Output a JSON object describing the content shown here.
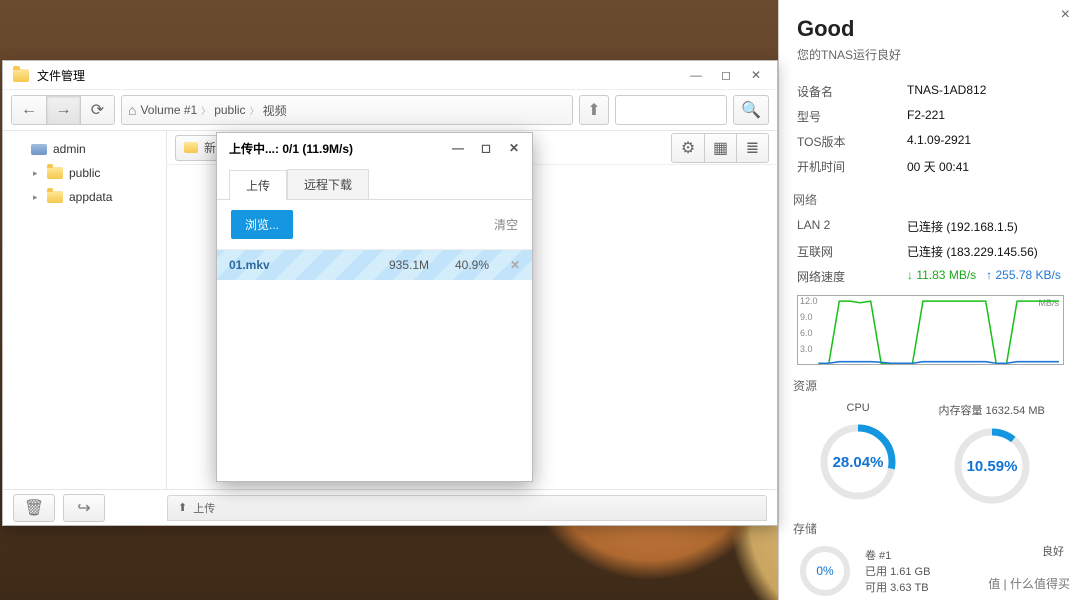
{
  "file_manager": {
    "title": "文件管理",
    "nav": {
      "back_icon": "←",
      "forward_icon": "→",
      "refresh_icon": "⟳"
    },
    "breadcrumb": [
      "Volume #1",
      "public",
      "视频"
    ],
    "search": {
      "placeholder": ""
    },
    "tree": {
      "root": "admin",
      "items": [
        "public",
        "appdata"
      ]
    },
    "new_folder_partial": "新",
    "view_icons": {
      "gear": "⚙",
      "grid": "▦",
      "list": "≣"
    },
    "footer": {
      "trash_icon": "🗑",
      "share_icon": "↪",
      "upload_tab_icon": "⬆",
      "upload_tab_label": "上传"
    }
  },
  "upload_dialog": {
    "title": "上传中...: 0/1 (11.9M/s)",
    "tabs": {
      "upload": "上传",
      "remote": "远程下载"
    },
    "browse": "浏览...",
    "clear": "清空",
    "item": {
      "name": "01.mkv",
      "size": "935.1M",
      "percent": "40.9%"
    }
  },
  "system": {
    "status_title": "Good",
    "status_sub": "您的TNAS运行良好",
    "close_icon": "×",
    "device": {
      "name_k": "设备名",
      "name_v": "TNAS-1AD812",
      "model_k": "型号",
      "model_v": "F2-221",
      "tos_k": "TOS版本",
      "tos_v": "4.1.09-2921",
      "uptime_k": "开机时间",
      "uptime_v": "00 天 00:41"
    },
    "network": {
      "header": "网络",
      "lan_k": "LAN 2",
      "lan_v": "已连接 (192.168.1.5)",
      "inet_k": "互联网",
      "inet_v": "已连接 (183.229.145.56)",
      "speed_k": "网络速度",
      "down": "11.83 MB/s",
      "up": "255.78 KB/s",
      "unit_label": "MB/s"
    },
    "resources": {
      "header": "资源",
      "cpu_label": "CPU",
      "cpu_pct": "28.04%",
      "mem_label": "内存容量 1632.54 MB",
      "mem_pct": "10.59%"
    },
    "storage": {
      "header": "存储",
      "vol": "卷 #1",
      "status": "良好",
      "pct": "0%",
      "used_k": "已用",
      "used_v": "1.61 GB",
      "avail_k": "可用",
      "avail_v": "3.63 TB"
    }
  },
  "chart_data": {
    "type": "line",
    "title": "",
    "xlabel": "",
    "ylabel": "MB/s",
    "ylim": [
      0,
      12
    ],
    "y_ticks": [
      3.0,
      6.0,
      9.0,
      12.0
    ],
    "series": [
      {
        "name": "download",
        "color": "#19c019",
        "values": [
          0,
          0,
          11.8,
          11.8,
          11.5,
          11.8,
          0,
          0,
          0,
          0,
          11.8,
          11.8,
          11.8,
          11.8,
          11.8,
          11.8,
          11.8,
          0,
          0,
          11.8,
          11.8,
          11.8,
          11.8,
          11.8
        ]
      },
      {
        "name": "upload",
        "color": "#1e77d8",
        "values": [
          0,
          0,
          0.3,
          0.3,
          0.3,
          0.3,
          0.2,
          0,
          0,
          0,
          0.3,
          0.3,
          0.3,
          0.3,
          0.3,
          0.3,
          0.3,
          0,
          0,
          0.3,
          0.3,
          0.3,
          0.3,
          0.3
        ]
      }
    ]
  },
  "watermark": "值 | 什么值得买"
}
